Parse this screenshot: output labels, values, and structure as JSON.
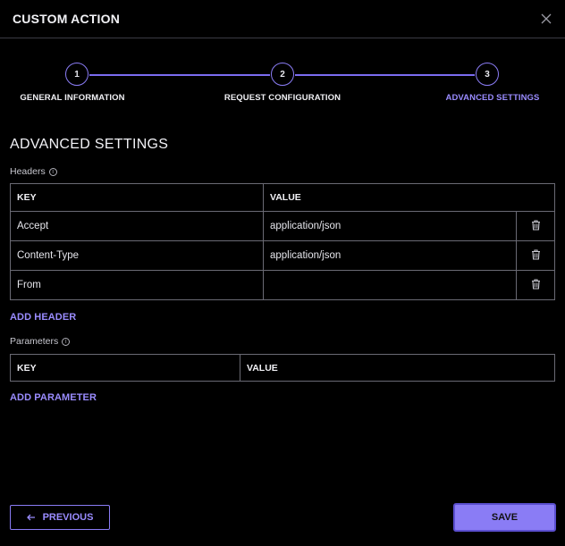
{
  "modal": {
    "title": "CUSTOM ACTION"
  },
  "stepper": {
    "steps": [
      {
        "number": "1",
        "label": "GENERAL INFORMATION"
      },
      {
        "number": "2",
        "label": "REQUEST CONFIGURATION"
      },
      {
        "number": "3",
        "label": "ADVANCED SETTINGS"
      }
    ],
    "active_step": 3
  },
  "section": {
    "title": "ADVANCED SETTINGS"
  },
  "headers": {
    "label": "Headers",
    "columns": [
      "KEY",
      "VALUE"
    ],
    "rows": [
      {
        "key": "Accept",
        "value": "application/json"
      },
      {
        "key": "Content-Type",
        "value": "application/json"
      },
      {
        "key": "From",
        "value": ""
      }
    ],
    "add_label": "ADD HEADER"
  },
  "parameters": {
    "label": "Parameters",
    "columns": [
      "KEY",
      "VALUE"
    ],
    "add_label": "ADD PARAMETER"
  },
  "footer": {
    "previous_label": "PREVIOUS",
    "save_label": "SAVE"
  },
  "colors": {
    "accent": "#8a7cf5",
    "background": "#000000",
    "border": "#6a6a74"
  }
}
